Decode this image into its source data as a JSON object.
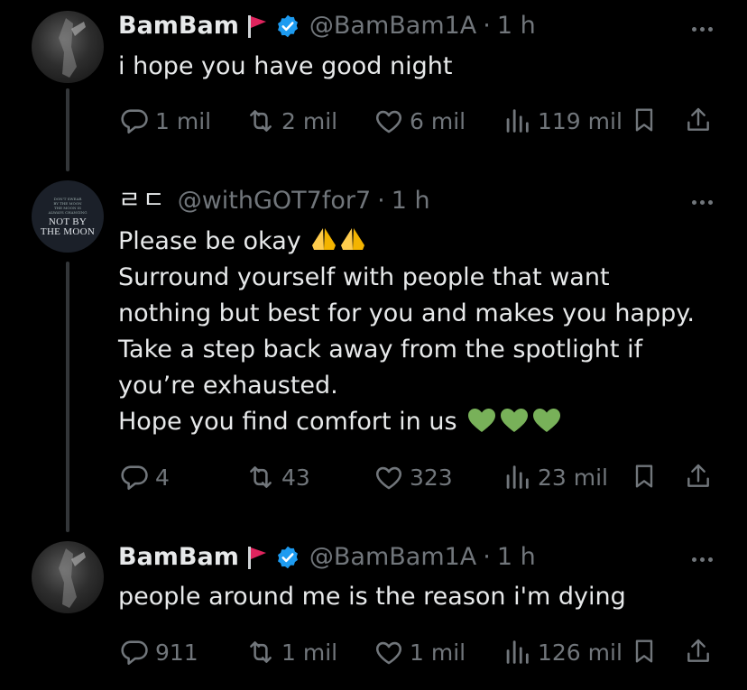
{
  "tweets": [
    {
      "name": "BamBam",
      "handle": "@BamBam1A",
      "time": "1 h",
      "text": "i hope you have good night",
      "replies": "1 mil",
      "reposts": "2 mil",
      "likes": "6 mil",
      "views": "119 mil"
    },
    {
      "name": "ㄹㄷ",
      "handle": "@withGOT7for7",
      "time": "1 h",
      "lines": [
        "Please be okay",
        "Surround yourself with people that want",
        "nothing but best for you and makes you happy.",
        "Take a step back away from the spotlight if",
        "you’re exhausted.",
        "Hope you find comfort in us"
      ],
      "avatar_text_main": "NOT BY THE MOON",
      "replies": "4",
      "reposts": "43",
      "likes": "323",
      "views": "23 mil"
    },
    {
      "name": "BamBam",
      "handle": "@BamBam1A",
      "time": "1 h",
      "text": "people around me is the reason i'm dying",
      "replies": "911",
      "reposts": "1 mil",
      "likes": "1 mil",
      "views": "126 mil"
    }
  ],
  "colors": {
    "background": "#000000",
    "text": "#e7e9ea",
    "muted": "#71767b",
    "verified": "#1d9bf0",
    "flag": "#e0245e",
    "thread_line": "#333639",
    "green_heart": "#78b159",
    "pray_emoji": "#ffcc4d"
  },
  "icons": [
    "red-flag-icon",
    "verified-badge-icon",
    "more-icon",
    "reply-icon",
    "repost-icon",
    "like-icon",
    "views-icon",
    "bookmark-icon",
    "share-icon"
  ]
}
